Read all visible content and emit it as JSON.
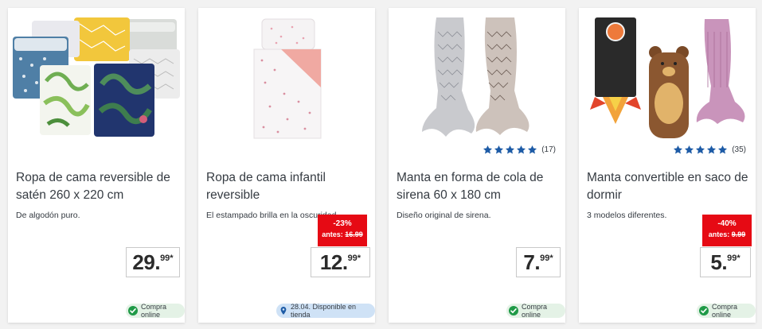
{
  "colors": {
    "star": "#1d5ba6",
    "discount": "#e60a14",
    "online": "#1f9a47",
    "store": "#cfe2f6"
  },
  "products": [
    {
      "title": "Ropa de cama reversible de satén 260 x 220 cm",
      "description": "De algodón puro.",
      "price_int": "29.",
      "price_dec": "99*",
      "availability": "Compra online"
    },
    {
      "title": "Ropa de cama infantil reversible",
      "description": "El estampado brilla en la oscuridad.",
      "discount_pct": "-23%",
      "old_price_label": "antes:",
      "old_price": "16.99",
      "price_int": "12.",
      "price_dec": "99*",
      "availability": "28.04.  Disponible en tienda"
    },
    {
      "title": "Manta en forma de cola de sirena 60 x 180 cm",
      "description": "Diseño original de sirena.",
      "rating_count": "(17)",
      "price_int": "7.",
      "price_dec": "99*",
      "availability": "Compra online"
    },
    {
      "title": "Manta convertible en saco de dormir",
      "description": "3 modelos diferentes.",
      "rating_count": "(35)",
      "discount_pct": "-40%",
      "old_price_label": "antes:",
      "old_price": "9.99",
      "price_int": "5.",
      "price_dec": "99*",
      "availability": "Compra online"
    }
  ]
}
